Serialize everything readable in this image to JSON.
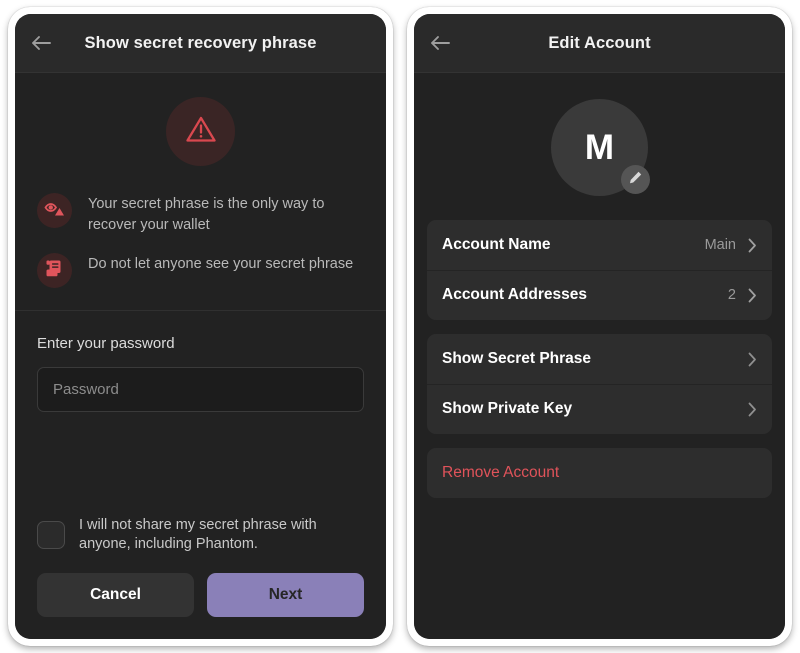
{
  "colors": {
    "accent_purple": "#8a80b8",
    "danger_red": "#e0535a",
    "warn_red": "#d9484f",
    "panel_bg": "#222222",
    "card_bg": "#2d2d2d",
    "header_bg": "#2a2a2a"
  },
  "left_panel": {
    "header": {
      "back_icon": "arrow-left-icon",
      "title": "Show secret recovery phrase"
    },
    "warning_badge_icon": "warning-triangle-icon",
    "warnings": [
      {
        "icon": "eye-warning-icon",
        "text": "Your secret phrase is the only way to recover your wallet"
      },
      {
        "icon": "scroll-document-icon",
        "text": "Do not let anyone see your secret phrase"
      }
    ],
    "password": {
      "label": "Enter your password",
      "placeholder": "Password",
      "value": ""
    },
    "checkbox": {
      "checked": false,
      "label": "I will not share my secret phrase with anyone, including Phantom."
    },
    "buttons": {
      "cancel": "Cancel",
      "next": "Next"
    }
  },
  "right_panel": {
    "header": {
      "back_icon": "arrow-left-icon",
      "title": "Edit Account"
    },
    "avatar": {
      "letter": "M",
      "edit_icon": "pencil-icon"
    },
    "groups": [
      {
        "rows": [
          {
            "label": "Account Name",
            "value": "Main",
            "chevron": true
          },
          {
            "label": "Account Addresses",
            "value": "2",
            "chevron": true
          }
        ]
      },
      {
        "rows": [
          {
            "label": "Show Secret Phrase",
            "value": "",
            "chevron": true
          },
          {
            "label": "Show Private Key",
            "value": "",
            "chevron": true
          }
        ]
      },
      {
        "rows": [
          {
            "label": "Remove Account",
            "value": "",
            "chevron": false
          }
        ]
      }
    ]
  }
}
